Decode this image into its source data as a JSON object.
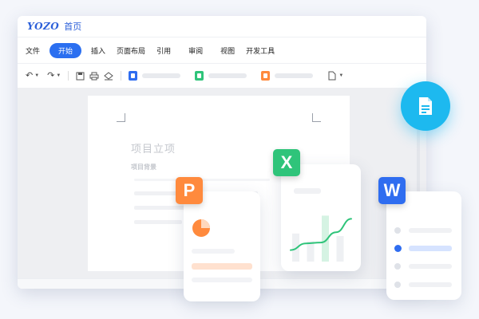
{
  "titlebar": {
    "logo": "YOZO",
    "home": "首页"
  },
  "menu": {
    "items": [
      "文件",
      "开始",
      "插入",
      "页面布局",
      "引用",
      "审阅",
      "视图",
      "开发工具"
    ],
    "active_index": 1
  },
  "toolbar": {
    "icons": [
      "undo-icon",
      "redo-icon",
      "save-icon",
      "print-icon",
      "eraser-icon",
      "ppt-file-icon",
      "excel-file-icon",
      "word-file-icon",
      "new-document-icon"
    ]
  },
  "document": {
    "title": "项目立项",
    "subtitle": "项目背景"
  },
  "badges": {
    "presentation": "P",
    "spreadsheet": "X",
    "writer": "W"
  },
  "colors": {
    "brand": "#2b5fd9",
    "accent_blue": "#2b6ff0",
    "presentation": "#ff8a3d",
    "spreadsheet": "#2fc47a",
    "writer": "#2f6df0",
    "fab": "#1db9ef"
  },
  "chart_data": {
    "type": "line",
    "series": [
      {
        "values": [
          0.15,
          0.3,
          0.32,
          0.55,
          0.85
        ]
      }
    ],
    "bars": [
      0.55,
      0.4,
      0.9,
      0.5
    ]
  }
}
